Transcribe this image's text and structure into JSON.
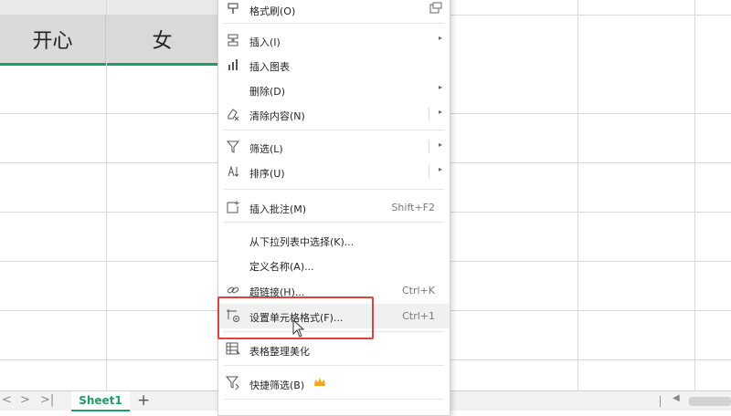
{
  "sheet": {
    "header_cells": [
      "开心",
      "女"
    ],
    "tab_name": "Sheet1",
    "add_sheet_label": "+",
    "nav_arrows": [
      "<",
      ">",
      ">|"
    ]
  },
  "menu": {
    "items": [
      {
        "label": "格式刷(O)",
        "icon": "format-painter-icon",
        "shortcut": ""
      },
      {
        "label": "插入(I)",
        "icon": "insert-icon",
        "shortcut": "",
        "submenu": true
      },
      {
        "label": "插入图表",
        "icon": "chart-icon",
        "shortcut": ""
      },
      {
        "label": "删除(D)",
        "icon": "",
        "shortcut": "",
        "submenu": true
      },
      {
        "label": "清除内容(N)",
        "icon": "eraser-icon",
        "shortcut": "",
        "submenu": true
      },
      {
        "label": "筛选(L)",
        "icon": "filter-icon",
        "shortcut": "",
        "submenu": true
      },
      {
        "label": "排序(U)",
        "icon": "sort-icon",
        "shortcut": "",
        "submenu": true
      },
      {
        "label": "插入批注(M)",
        "icon": "comment-icon",
        "shortcut": "Shift+F2"
      },
      {
        "label": "从下拉列表中选择(K)...",
        "icon": "",
        "shortcut": ""
      },
      {
        "label": "定义名称(A)...",
        "icon": "",
        "shortcut": ""
      },
      {
        "label": "超链接(H)...",
        "icon": "hyperlink-icon",
        "shortcut": "Ctrl+K"
      },
      {
        "label": "设置单元格格式(F)...",
        "icon": "format-cells-icon",
        "shortcut": "Ctrl+1"
      },
      {
        "label": "表格整理美化",
        "icon": "table-beautify-icon",
        "shortcut": ""
      },
      {
        "label": "快捷筛选(B)",
        "icon": "quick-filter-icon",
        "shortcut": ""
      }
    ]
  },
  "colors": {
    "accent_green": "#1e9d66",
    "highlight_red": "#d9453e",
    "crown": "#f5a623"
  }
}
